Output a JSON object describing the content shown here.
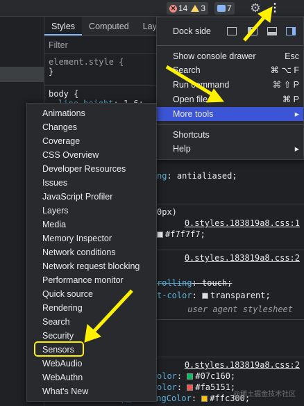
{
  "topbar": {
    "errors_count": "14",
    "warnings_count": "3",
    "messages_count": "7",
    "gear_icon": "gear-icon",
    "kebab_icon": "kebab-menu-icon",
    "kebab_glyph": "⋮",
    "gear_glyph": "⚙"
  },
  "styles_pane": {
    "tabs": [
      {
        "label": "Styles"
      },
      {
        "label": "Computed"
      },
      {
        "label": "Layo"
      }
    ],
    "filter_placeholder": "Filter",
    "element_style": "element.style {",
    "close_brace": "}",
    "body_selector": "body {",
    "body_prop": "line-height",
    "body_val": "1.6;",
    "smoothing_prop": "ng",
    "smoothing_val": "antialiased;",
    "media_frag": "0px)",
    "source1": "0.styles.183819a8.css:1",
    "color1": "#f7f7f7;",
    "source2": "0.styles.183819a8.css:2",
    "scroll_prop": "rolling",
    "scroll_val": "touch;",
    "tap_prop": "t-color",
    "tap_val": "transparent;",
    "ua_label": "user agent stylesheet",
    "source3": "0.styles.183819a8.css:2",
    "c1_prop": "olor",
    "c1_val": "#07c160;",
    "c2_prop": "olor",
    "c2_val": "#fa5151;",
    "c3_prop": "--weuiDesktop_WarningColor",
    "c3_val": "#ffc300;"
  },
  "main_menu": {
    "dock_side": "Dock side",
    "items": [
      {
        "label": "Show console drawer",
        "shortcut": "Esc"
      },
      {
        "label": "Search",
        "shortcut": "⌘ ⌥ F"
      },
      {
        "label": "Run command",
        "shortcut": "⌘ ⇧ P"
      },
      {
        "label": "Open file",
        "shortcut": "⌘ P"
      },
      {
        "label": "More tools",
        "shortcut": "▸"
      },
      {
        "label": "Shortcuts",
        "shortcut": ""
      },
      {
        "label": "Help",
        "shortcut": "▸"
      }
    ]
  },
  "more_tools_menu": {
    "items": [
      "Animations",
      "Changes",
      "Coverage",
      "CSS Overview",
      "Developer Resources",
      "Issues",
      "JavaScript Profiler",
      "Layers",
      "Media",
      "Memory Inspector",
      "Network conditions",
      "Network request blocking",
      "Performance monitor",
      "Quick source",
      "Rendering",
      "Search",
      "Security",
      "Sensors",
      "WebAudio",
      "WebAuthn",
      "What's New"
    ],
    "highlighted": "Sensors"
  },
  "annotation": {
    "highlight_color": "#fff200"
  },
  "watermark": "@稀土掘金技术社区"
}
